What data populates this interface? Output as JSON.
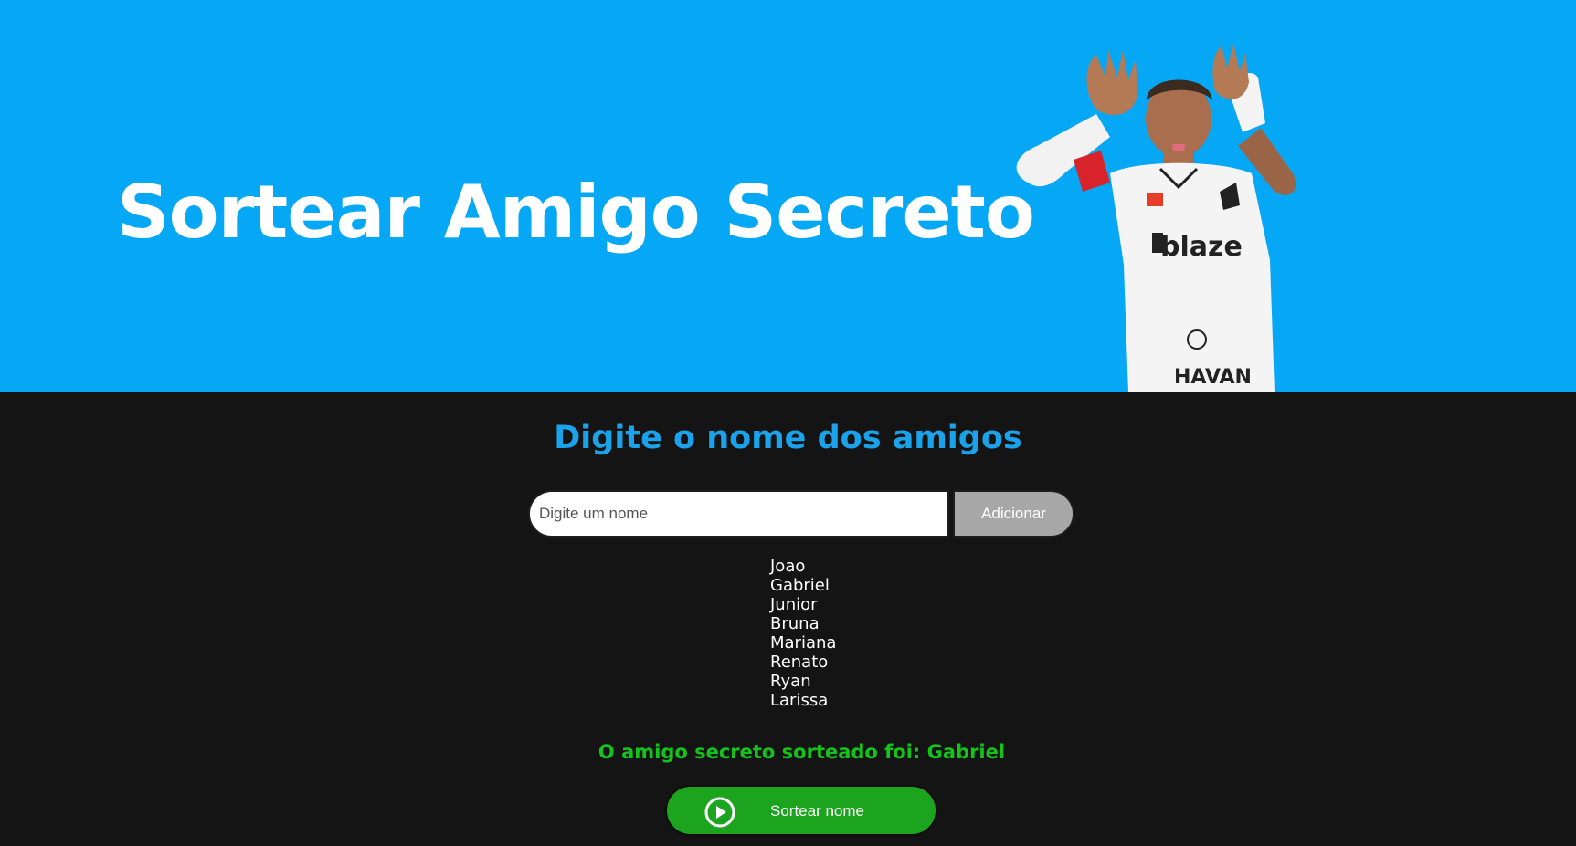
{
  "header": {
    "title": "Sortear Amigo Secreto",
    "background_color": "#06a8f5",
    "image": "football-player-celebration-image"
  },
  "main": {
    "section_title": "Digite o nome dos amigos",
    "input": {
      "placeholder": "Digite um nome",
      "value": ""
    },
    "add_button_label": "Adicionar",
    "friends": [
      "Joao",
      "Gabriel",
      "Junior",
      "Bruna",
      "Mariana",
      "Renato",
      "Ryan",
      "Larissa"
    ],
    "result_text": "O amigo secreto sorteado foi: Gabriel",
    "draw_button": {
      "label": "Sortear nome",
      "icon": "play-circle-icon"
    }
  },
  "colors": {
    "accent_blue": "#1aa3ea",
    "result_green": "#15c21b",
    "button_green": "#1ca41f",
    "dark_background": "#141414"
  }
}
